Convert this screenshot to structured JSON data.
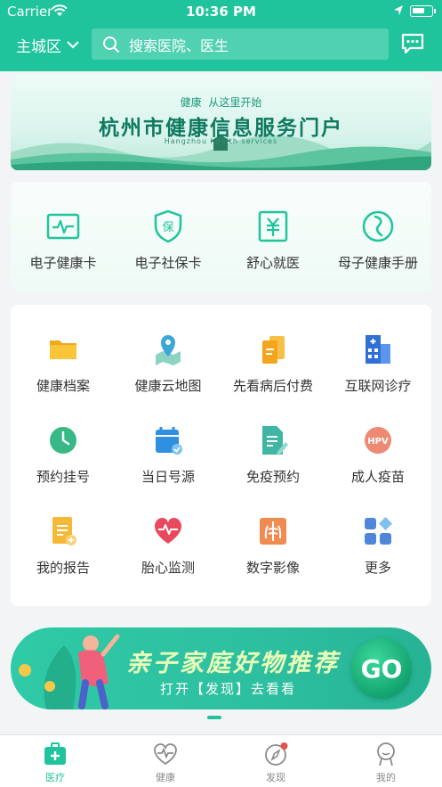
{
  "status_bar": {
    "carrier": "Carrier",
    "time": "10:36 PM"
  },
  "header": {
    "city": "主城区",
    "search_placeholder": "搜索医院、医生"
  },
  "banner": {
    "subtitle_prefix": "健康",
    "subtitle": "从这里开始",
    "title": "杭州市健康信息服务门户",
    "subtitle_en": "Hangzhou health services"
  },
  "quick_services": [
    {
      "label": "电子健康卡",
      "icon": "health-card-icon"
    },
    {
      "label": "电子社保卡",
      "icon": "social-security-icon"
    },
    {
      "label": "舒心就医",
      "icon": "payment-icon"
    },
    {
      "label": "母子健康手册",
      "icon": "mother-child-icon"
    }
  ],
  "services": [
    {
      "label": "健康档案",
      "icon": "folder-icon"
    },
    {
      "label": "健康云地图",
      "icon": "map-pin-icon"
    },
    {
      "label": "先看病后付费",
      "icon": "documents-icon"
    },
    {
      "label": "互联网诊疗",
      "icon": "hospital-icon"
    },
    {
      "label": "预约挂号",
      "icon": "clock-icon"
    },
    {
      "label": "当日号源",
      "icon": "calendar-icon"
    },
    {
      "label": "免疫预约",
      "icon": "document-pen-icon"
    },
    {
      "label": "成人疫苗",
      "icon": "hpv-icon",
      "badge": "HPV"
    },
    {
      "label": "我的报告",
      "icon": "report-icon"
    },
    {
      "label": "胎心监测",
      "icon": "heartbeat-icon"
    },
    {
      "label": "数字影像",
      "icon": "xray-icon"
    },
    {
      "label": "更多",
      "icon": "more-grid-icon"
    }
  ],
  "promo": {
    "title": "亲子家庭好物推荐",
    "subtitle": "打开【发现】去看看",
    "button": "GO"
  },
  "tabs": [
    {
      "label": "医疗",
      "active": true
    },
    {
      "label": "健康",
      "active": false
    },
    {
      "label": "发现",
      "active": false
    },
    {
      "label": "我的",
      "active": false
    }
  ],
  "colors": {
    "brand": "#1fc49c",
    "notification_dot": "#e0534a"
  }
}
